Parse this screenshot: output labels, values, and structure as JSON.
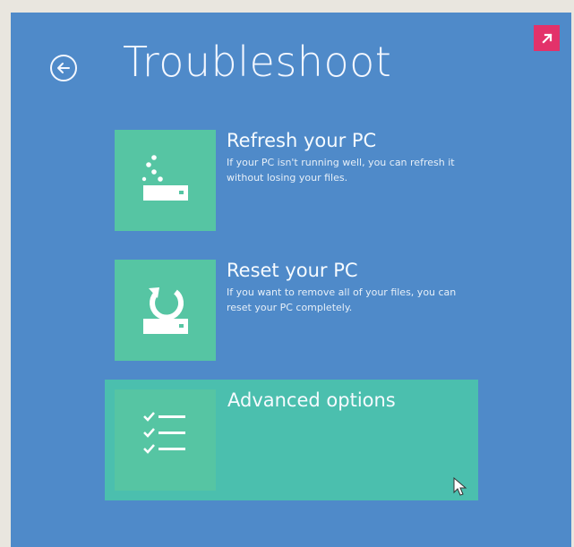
{
  "header": {
    "title": "Troubleshoot"
  },
  "options": [
    {
      "title": "Refresh your PC",
      "description": "If your PC isn't running well, you can refresh it without losing your files.",
      "icon": "refresh-pc-icon"
    },
    {
      "title": "Reset your PC",
      "description": "If you want to remove all of your files, you can reset your PC completely.",
      "icon": "reset-pc-icon"
    },
    {
      "title": "Advanced options",
      "description": "",
      "icon": "checklist-icon"
    }
  ],
  "colors": {
    "background": "#4f8ac9",
    "tile": "#56c5a3",
    "selected_tile": "#4bbfae",
    "badge": "#e3326a",
    "text": "#f3f7ff"
  }
}
